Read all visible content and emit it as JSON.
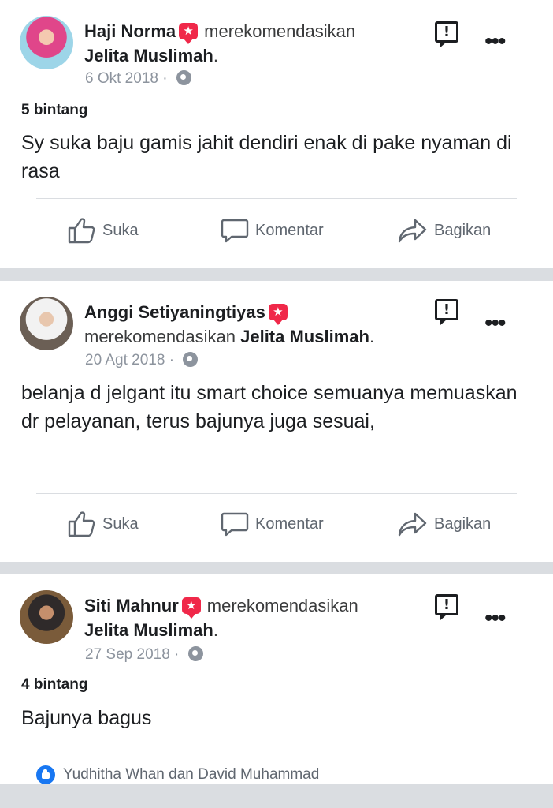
{
  "posts": [
    {
      "author": "Haji Norma",
      "recommends": "merekomendasikan",
      "page": "Jelita Muslimah",
      "date": "6 Okt 2018",
      "rating": "5 bintang",
      "text": "Sy suka baju gamis jahit dendiri enak di pake nyaman di rasa"
    },
    {
      "author": "Anggi Setiyaningtiyas",
      "recommends": "merekomendasikan",
      "page": "Jelita Muslimah",
      "date": "20 Agt 2018",
      "rating": "",
      "text": "belanja d jelgant itu smart choice semuanya memuaskan dr pelayanan, terus bajunya juga sesuai,"
    },
    {
      "author": "Siti Mahnur",
      "recommends": "merekomendasikan",
      "page": "Jelita Muslimah",
      "date": "27 Sep 2018",
      "rating": "4 bintang",
      "text": "Bajunya bagus",
      "reactions": "Yudhitha Whan dan David Muhammad"
    }
  ],
  "actions": {
    "like": "Suka",
    "comment": "Komentar",
    "share": "Bagikan"
  },
  "separators": {
    "dot": "·",
    "period": "."
  },
  "icons": {
    "badge": "recommendation-star-icon",
    "privacy": "globe-icon",
    "report": "report-icon",
    "more": "more-options-icon",
    "like": "thumbs-up-icon",
    "comment": "comment-bubble-icon",
    "share": "share-arrow-icon"
  },
  "colors": {
    "badge": "#f02849",
    "like_blue": "#1877f2",
    "muted": "#8d949e"
  }
}
